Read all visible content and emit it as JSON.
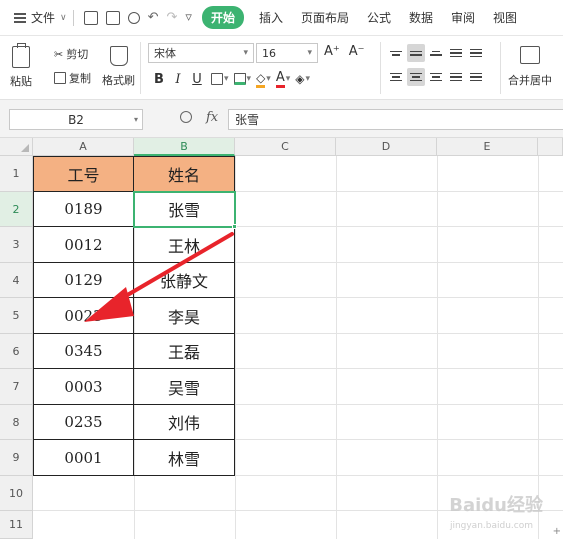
{
  "menubar": {
    "file_label": "文件",
    "tabs": [
      {
        "label": "开始",
        "active": true
      },
      {
        "label": "插入",
        "active": false
      },
      {
        "label": "页面布局",
        "active": false
      },
      {
        "label": "公式",
        "active": false
      },
      {
        "label": "数据",
        "active": false
      },
      {
        "label": "审阅",
        "active": false
      },
      {
        "label": "视图",
        "active": false
      }
    ],
    "accent_color": "#3cb371"
  },
  "ribbon": {
    "paste_label": "粘贴",
    "cut_label": "剪切",
    "copy_label": "复制",
    "format_painter_label": "格式刷",
    "font_name": "宋体",
    "font_size": "16",
    "merge_label": "合并居中",
    "bold_label": "B",
    "italic_label": "I",
    "underline_label": "U",
    "font_color_label": "A",
    "grow_font_label": "A⁺",
    "shrink_font_label": "A⁻"
  },
  "formula_bar": {
    "name_box": "B2",
    "fx_label": "fx",
    "formula_value": "张雪"
  },
  "sheet": {
    "columns": [
      "A",
      "B",
      "C",
      "D",
      "E"
    ],
    "active_column": "B",
    "rows": [
      "1",
      "2",
      "3",
      "4",
      "5",
      "6",
      "7",
      "8",
      "9",
      "10",
      "11"
    ],
    "active_row": "2",
    "header_fill_color": "#f4b183",
    "header": {
      "a": "工号",
      "b": "姓名"
    },
    "data": [
      {
        "a": "0189",
        "b": "张雪"
      },
      {
        "a": "0012",
        "b": "王林"
      },
      {
        "a": "0129",
        "b": "张静文"
      },
      {
        "a": "0023",
        "b": "李昊"
      },
      {
        "a": "0345",
        "b": "王磊"
      },
      {
        "a": "0003",
        "b": "吴雪"
      },
      {
        "a": "0235",
        "b": "刘伟"
      },
      {
        "a": "0001",
        "b": "林雪"
      }
    ]
  },
  "annotation": {
    "arrow_color": "#e8242b"
  },
  "watermark": {
    "text": "Baidu经验",
    "sub": "jingyan.baidu.com"
  }
}
